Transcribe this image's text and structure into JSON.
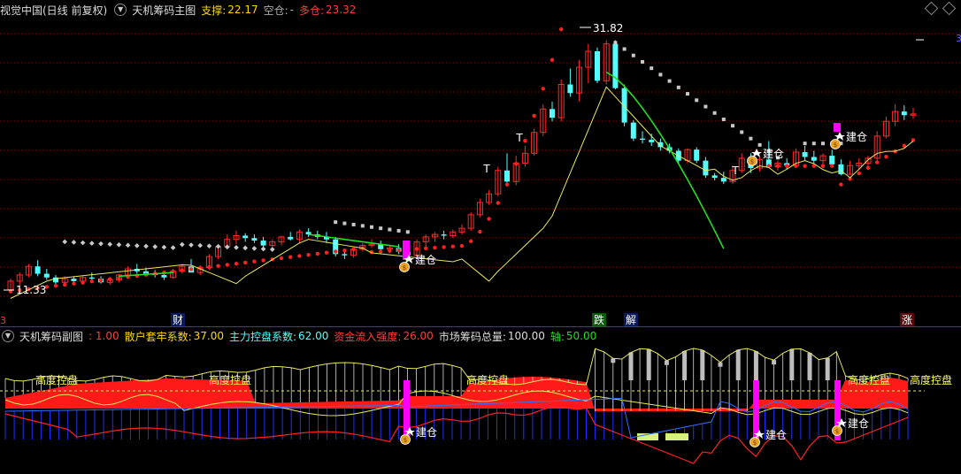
{
  "main_header": {
    "title": "视觉中国(日线 前复权)",
    "indicator": "天机筹码主图",
    "support_label": "支撑:",
    "support_value": "22.17",
    "empty_label": "空仓:",
    "empty_value": "-",
    "long_label": "多仓:",
    "long_value": "23.32"
  },
  "sub_header": {
    "indicator": "天机筹码副图",
    "v1": ": 1.00",
    "retail_label": "散户套牢系数:",
    "retail_value": "37.00",
    "main_label": "主力控盘系数:",
    "main_value": "62.00",
    "flow_label": "资金流入强度:",
    "flow_value": "26.00",
    "total_label": "市场筹码总量:",
    "total_value": "100.00",
    "axis_label": "轴:",
    "axis_value": "50.00"
  },
  "price_labels": {
    "high": "31.82",
    "low": "11.33",
    "right_edge": "3"
  },
  "signals": {
    "build": "建仓",
    "control": "高度控盘",
    "events": [
      "财",
      "跌",
      "解",
      "涨"
    ],
    "left_edge": "3"
  },
  "colors": {
    "up": "#ff2a2a",
    "down": "#54ffff",
    "white": "#ffffff",
    "green_line": "#22dd22",
    "yellow_line": "#e8e860",
    "magenta": "#ff00ff",
    "grid": "#8a0000"
  }
}
